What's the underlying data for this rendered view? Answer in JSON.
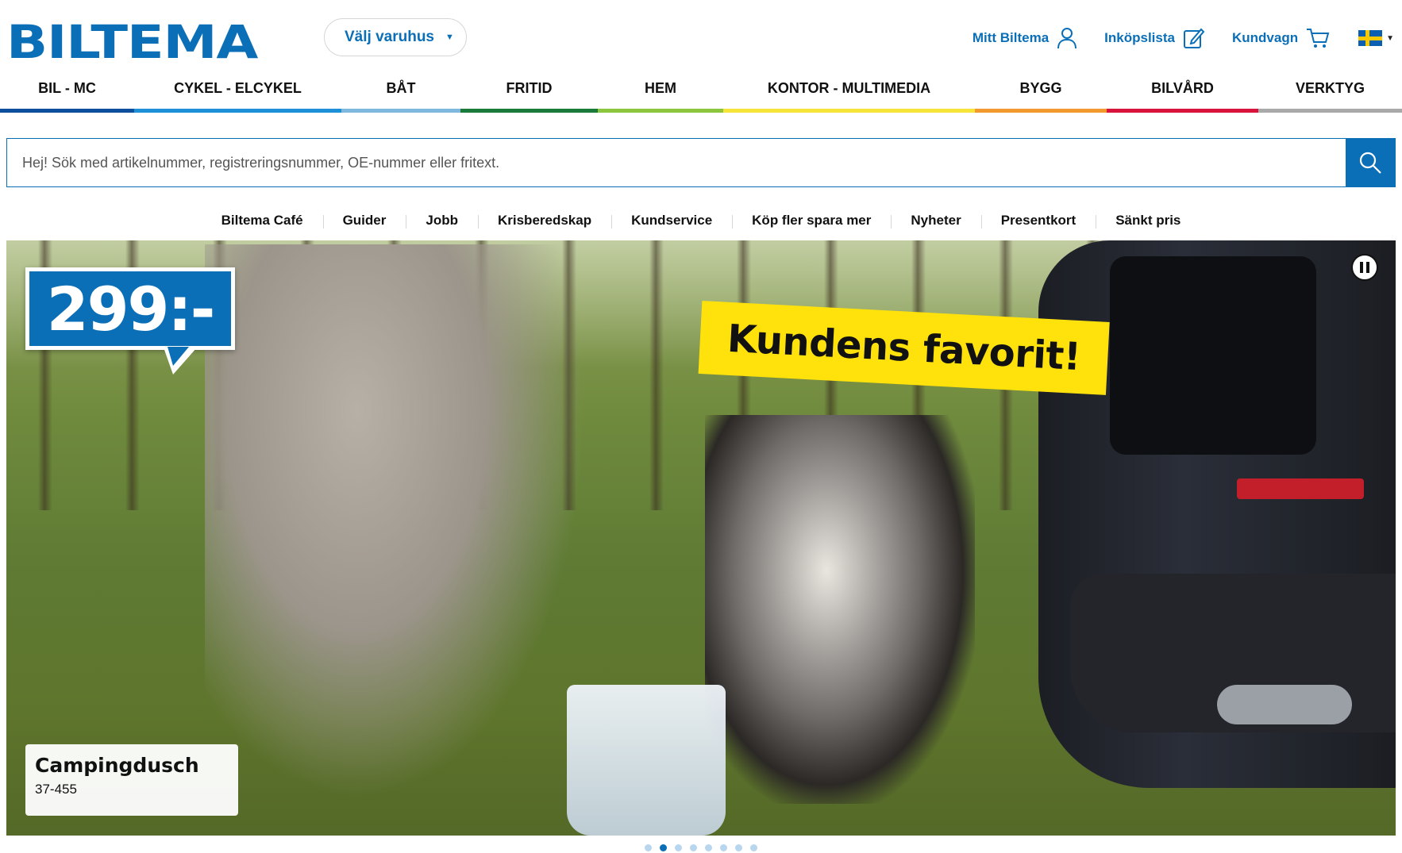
{
  "header": {
    "logo": "BILTEMA",
    "store_select": "Välj varuhus",
    "links": {
      "account": "Mitt Biltema",
      "shopping_list": "Inköpslista",
      "cart": "Kundvagn"
    },
    "flag": "sweden-flag"
  },
  "categories": [
    {
      "label": "BIL - MC",
      "color": "#0d4f9c"
    },
    {
      "label": "CYKEL - ELCYKEL",
      "color": "#1e90d8"
    },
    {
      "label": "BÅT",
      "color": "#7fb8dd"
    },
    {
      "label": "FRITID",
      "color": "#1a7a3a"
    },
    {
      "label": "HEM",
      "color": "#8cc63e"
    },
    {
      "label": "KONTOR - MULTIMEDIA",
      "color": "#f7e43a"
    },
    {
      "label": "BYGG",
      "color": "#f29a2e"
    },
    {
      "label": "BILVÅRD",
      "color": "#d9143c"
    },
    {
      "label": "VERKTYG",
      "color": "#a9a9a9"
    }
  ],
  "search": {
    "placeholder": "Hej! Sök med artikelnummer, registreringsnummer, OE-nummer eller fritext."
  },
  "sublinks": [
    "Biltema Café",
    "Guider",
    "Jobb",
    "Krisberedskap",
    "Kundservice",
    "Köp fler spara mer",
    "Nyheter",
    "Presentkort",
    "Sänkt pris"
  ],
  "hero": {
    "price": "299:-",
    "badge": "Kundens favorit!",
    "product_name": "Campingdusch",
    "product_number": "37-455",
    "slides_total": 8,
    "active_slide": 2
  },
  "colors": {
    "brand": "#0b6fb8",
    "badge": "#ffe20b"
  }
}
